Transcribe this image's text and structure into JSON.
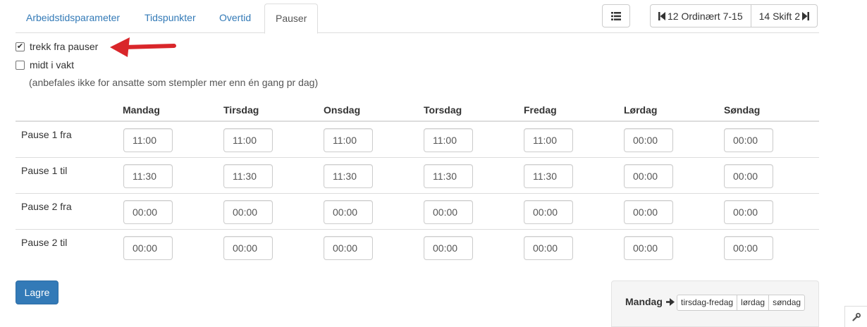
{
  "tabs": [
    {
      "label": "Arbeidstidsparameter",
      "active": false
    },
    {
      "label": "Tidspunkter",
      "active": false
    },
    {
      "label": "Overtid",
      "active": false
    },
    {
      "label": "Pauser",
      "active": true
    }
  ],
  "toolbar": {
    "list_icon": "list-icon",
    "prev_label": "12 Ordinært 7-15",
    "prev_icon": "skip-back-icon",
    "next_label": "14 Skift 2",
    "next_icon": "skip-forward-icon"
  },
  "options": {
    "deduct_breaks": {
      "label": "trekk fra pauser",
      "checked": true
    },
    "mid_shift": {
      "label": "midt i vakt",
      "checked": false
    },
    "hint": "(anbefales ikke for ansatte som stempler mer enn én gang pr dag)"
  },
  "schedule": {
    "days": [
      "Mandag",
      "Tirsdag",
      "Onsdag",
      "Torsdag",
      "Fredag",
      "Lørdag",
      "Søndag"
    ],
    "rows": [
      {
        "label": "Pause 1 fra",
        "values": [
          "11:00",
          "11:00",
          "11:00",
          "11:00",
          "11:00",
          "00:00",
          "00:00"
        ]
      },
      {
        "label": "Pause 1 til",
        "values": [
          "11:30",
          "11:30",
          "11:30",
          "11:30",
          "11:30",
          "00:00",
          "00:00"
        ]
      },
      {
        "label": "Pause 2 fra",
        "values": [
          "00:00",
          "00:00",
          "00:00",
          "00:00",
          "00:00",
          "00:00",
          "00:00"
        ]
      },
      {
        "label": "Pause 2 til",
        "values": [
          "00:00",
          "00:00",
          "00:00",
          "00:00",
          "00:00",
          "00:00",
          "00:00"
        ]
      }
    ]
  },
  "save_label": "Lagre",
  "copy": {
    "from_label": "Mandag",
    "arrow_icon": "arrow-right-icon",
    "targets": [
      "tirsdag-fredag",
      "lørdag",
      "søndag"
    ]
  },
  "colors": {
    "accent": "#337ab7",
    "annotation_arrow": "#d9262a"
  },
  "wrench_icon": "wrench-icon"
}
